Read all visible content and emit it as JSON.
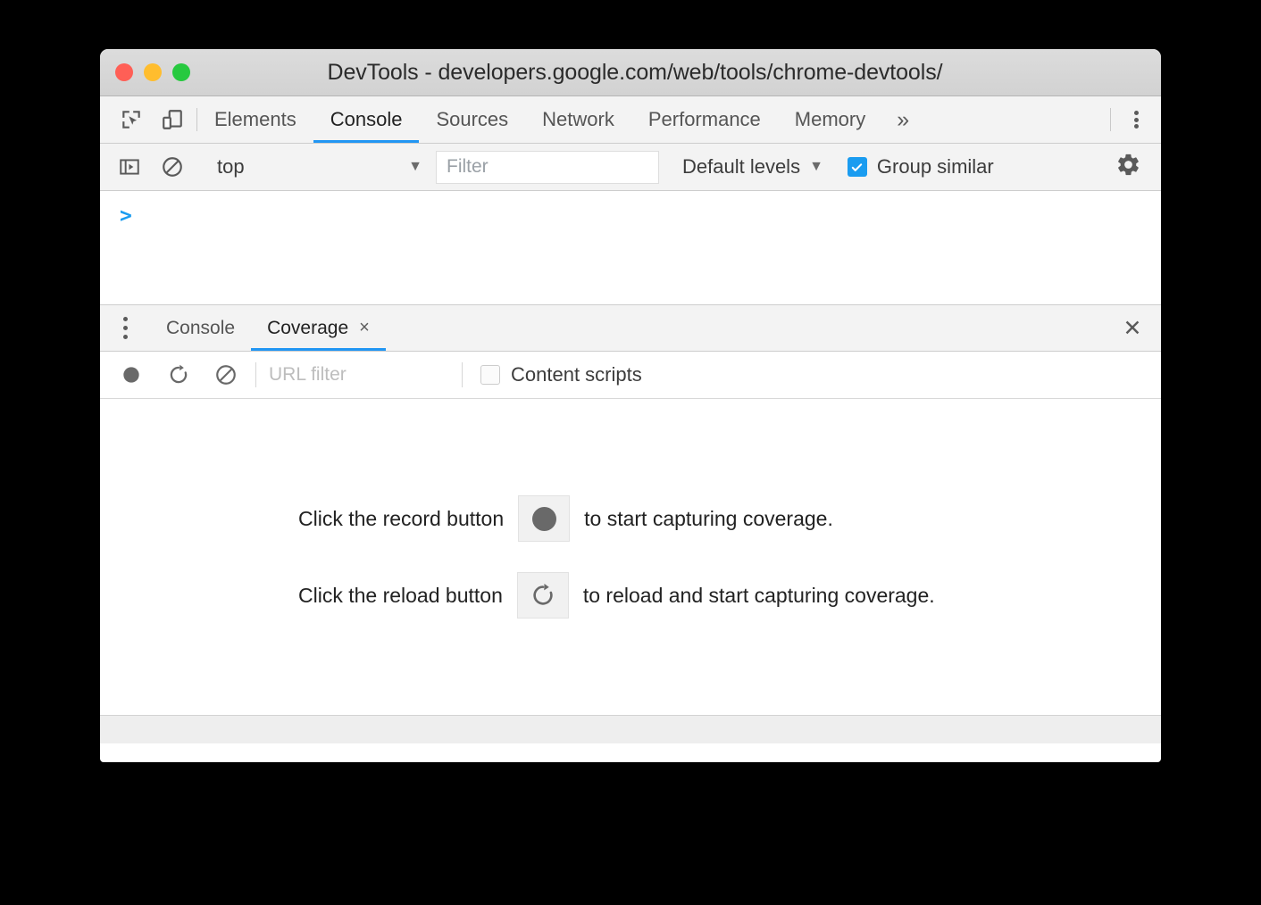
{
  "window": {
    "title": "DevTools - developers.google.com/web/tools/chrome-devtools/",
    "traffic_lights": [
      {
        "name": "close",
        "color": "#ff5f56"
      },
      {
        "name": "minimize",
        "color": "#ffbd2e"
      },
      {
        "name": "zoom",
        "color": "#27c93f"
      }
    ]
  },
  "toolbar_icons": {
    "inspect": "inspect-element-icon",
    "device": "device-toolbar-icon",
    "kebab": "customize-and-control-icon"
  },
  "main_tabs": {
    "items": [
      {
        "label": "Elements",
        "active": false
      },
      {
        "label": "Console",
        "active": true
      },
      {
        "label": "Sources",
        "active": false
      },
      {
        "label": "Network",
        "active": false
      },
      {
        "label": "Performance",
        "active": false
      },
      {
        "label": "Memory",
        "active": false
      }
    ],
    "overflow_label": "»",
    "active_underline_color": "#2196f3"
  },
  "console_toolbar": {
    "sidebar_toggle_icon": "console-sidebar-icon",
    "clear_icon": "clear-console-icon",
    "context": "top",
    "context_caret": "▼",
    "filter_placeholder": "Filter",
    "levels_label": "Default levels",
    "levels_caret": "▼",
    "group_similar_label": "Group similar",
    "group_similar_checked": true,
    "checkbox_color": "#1a9cf0",
    "settings_icon": "gear-icon"
  },
  "console_output": {
    "prompt": ">"
  },
  "drawer": {
    "more_options_icon": "more-options-icon",
    "tabs": [
      {
        "label": "Console",
        "active": false,
        "closable": false
      },
      {
        "label": "Coverage",
        "active": true,
        "closable": true
      }
    ],
    "tab_close_glyph": "×",
    "close_drawer_glyph": "✕",
    "active_underline_color": "#2196f3"
  },
  "coverage_toolbar": {
    "record_icon": "record-icon",
    "reload_icon": "reload-icon",
    "clear_icon": "clear-icon",
    "url_filter_placeholder": "URL filter",
    "content_scripts_label": "Content scripts",
    "content_scripts_checked": false
  },
  "coverage_body": {
    "hints": [
      {
        "before": "Click the record button",
        "icon": "record-icon",
        "after": "to start capturing coverage."
      },
      {
        "before": "Click the reload button",
        "icon": "reload-icon",
        "after": "to reload and start capturing coverage."
      }
    ]
  }
}
